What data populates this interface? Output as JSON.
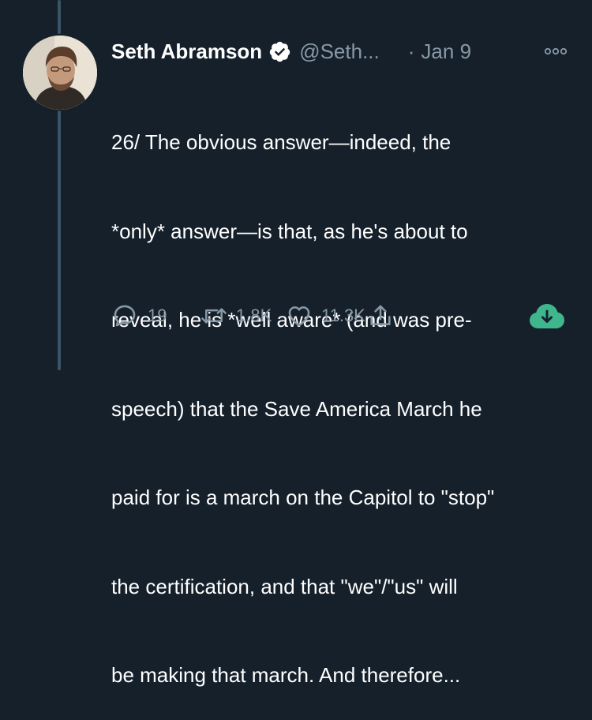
{
  "tweet": {
    "author_name": "Seth Abramson",
    "handle": "@Seth...",
    "separator": "·",
    "date": "Jan 9",
    "text_lines": [
      "26/ The obvious answer—indeed, the",
      "*only* answer—is that, as he's about to",
      "reveal, he is *well aware* (and was pre-",
      "speech) that the Save America March he",
      "paid for is a march on the Capitol to \"stop\"",
      "the certification, and that \"we\"/\"us\" will",
      "be making that march. And therefore..."
    ]
  },
  "actions": {
    "replies": "19",
    "retweets": "1.8K",
    "likes": "11.3K"
  },
  "colors": {
    "background": "#15202b",
    "secondary_text": "#8899a6",
    "thread_line": "#3d5466",
    "download_badge": "#3fb68b"
  },
  "icons": [
    "verified-badge-icon",
    "more-options-icon",
    "reply-icon",
    "retweet-icon",
    "like-icon",
    "share-icon",
    "cloud-download-icon"
  ]
}
